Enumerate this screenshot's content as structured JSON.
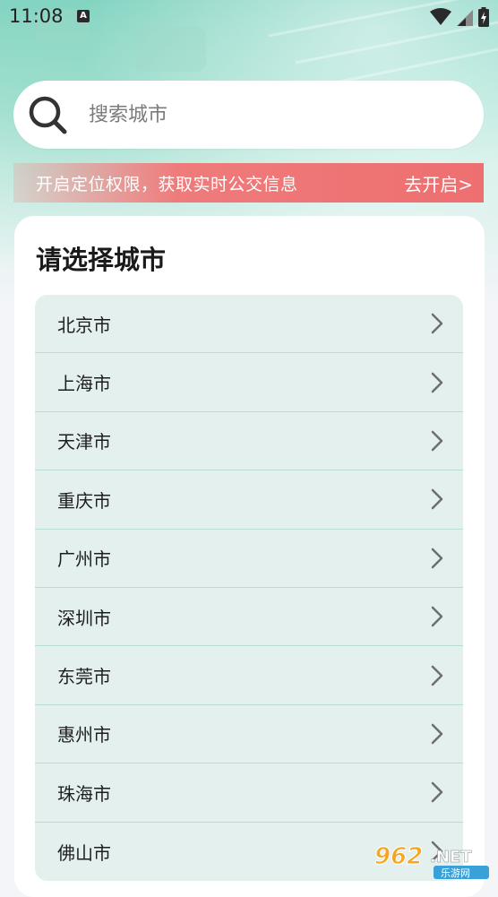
{
  "status_bar": {
    "time": "11:08",
    "notification_icon": "A"
  },
  "search": {
    "placeholder": "搜索城市",
    "icon": "search-icon"
  },
  "location_banner": {
    "text": "开启定位权限，获取实时公交信息",
    "action_label": "去开启>"
  },
  "city_card": {
    "title": "请选择城市",
    "cities": [
      {
        "name": "北京市"
      },
      {
        "name": "上海市"
      },
      {
        "name": "天津市"
      },
      {
        "name": "重庆市"
      },
      {
        "name": "广州市"
      },
      {
        "name": "深圳市"
      },
      {
        "name": "东莞市"
      },
      {
        "name": "惠州市"
      },
      {
        "name": "珠海市"
      },
      {
        "name": "佛山市"
      }
    ]
  },
  "watermark": {
    "brand": "962.NET",
    "subtitle": "乐游网"
  },
  "colors": {
    "header_teal": "#7fd2c1",
    "banner_red": "#ee6f6f",
    "list_bg": "#e3f0ee",
    "divider": "#b9dbd5"
  }
}
